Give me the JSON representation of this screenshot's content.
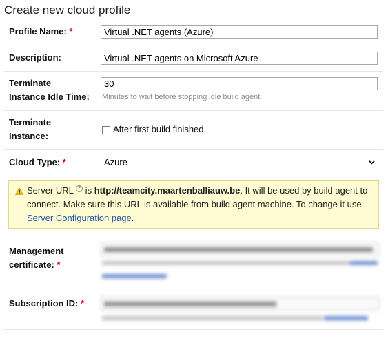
{
  "page": {
    "title": "Create new cloud profile"
  },
  "form": {
    "profile_name": {
      "label": "Profile Name:",
      "required": "*",
      "value": "Virtual .NET agents (Azure)"
    },
    "description": {
      "label": "Description:",
      "value": "Virtual .NET agents on Microsoft Azure"
    },
    "idle_time": {
      "label_line1": "Terminate",
      "label_line2": "Instance Idle Time:",
      "value": "30",
      "hint": "Minutes to wait before stopping idle build agent"
    },
    "terminate_instance": {
      "label_line1": "Terminate",
      "label_line2": "Instance:",
      "checkbox_label": "After first build finished",
      "checked": false
    },
    "cloud_type": {
      "label": "Cloud Type:",
      "required": "*",
      "value": "Azure"
    },
    "warning": {
      "text_before": "Server URL",
      "help_glyph": "?",
      "text_is": " is ",
      "url": "http://teamcity.maartenballiauw.be",
      "text_after": ". It will be used by build agent to connect. Make sure this URL is available from build agent machine. To change it use ",
      "link": "Server Configuration page",
      "text_end": "."
    },
    "management_certificate": {
      "label_line1": "Management",
      "label_line2": "certificate:",
      "required": "*",
      "value": "",
      "hint": ""
    },
    "subscription_id": {
      "label": "Subscription ID:",
      "required": "*",
      "value": "",
      "hint": ""
    }
  },
  "colors": {
    "required": "#d6000f",
    "link": "#2255aa",
    "warning_bg": "#fffbd3",
    "warning_border": "#e5d48a"
  }
}
